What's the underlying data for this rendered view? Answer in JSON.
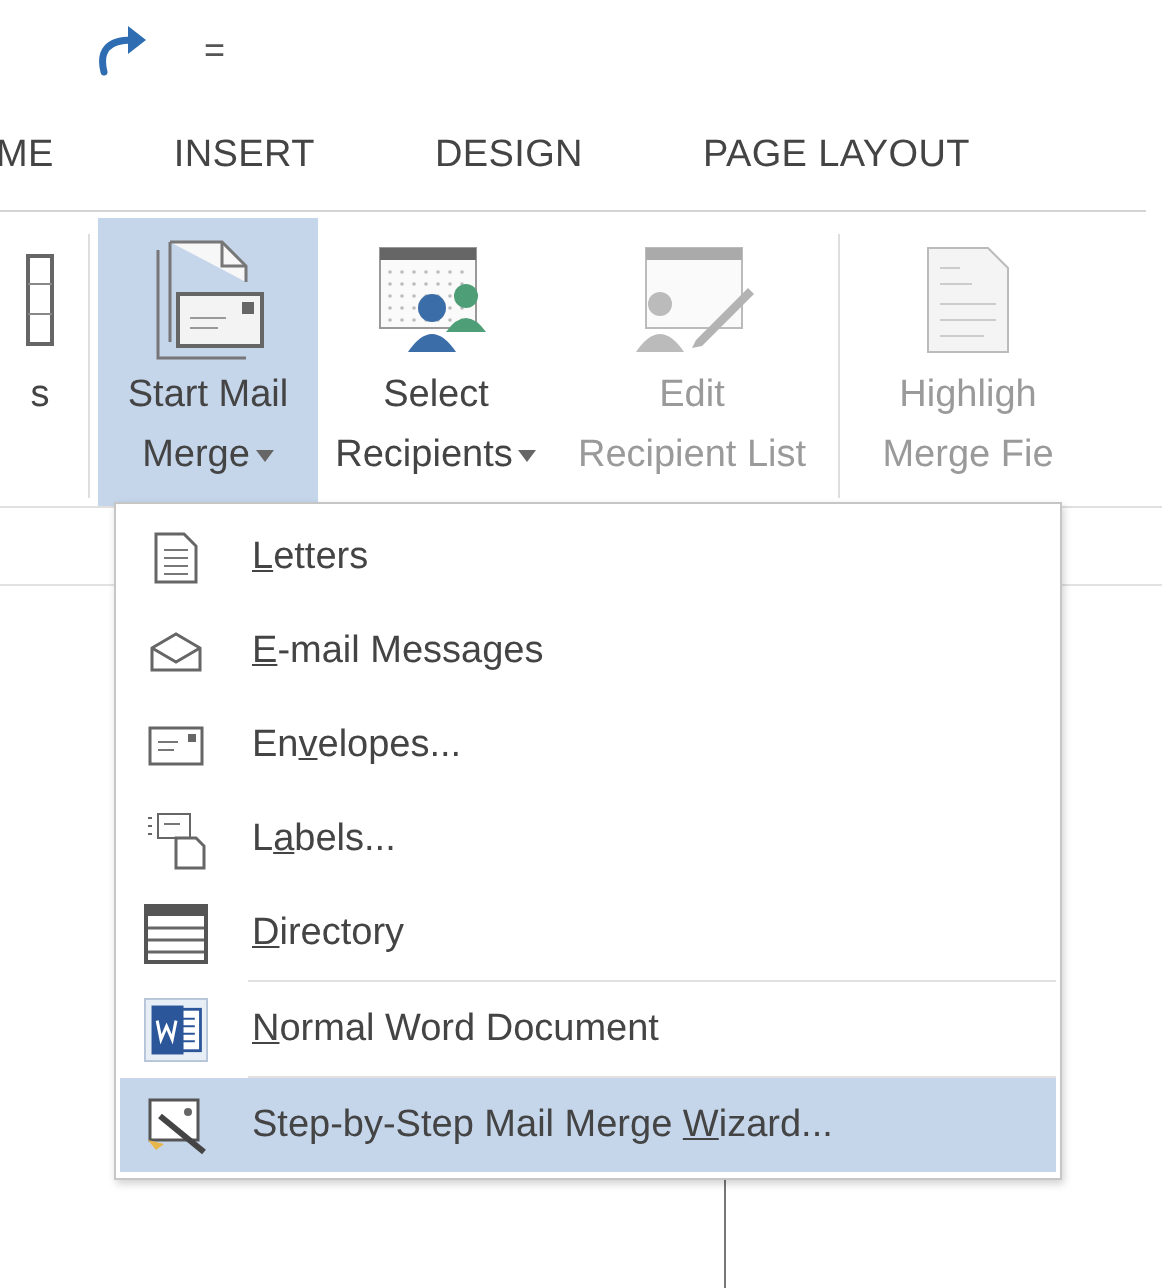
{
  "quick_access": {
    "customize": "="
  },
  "tabs": [
    {
      "label": "ME",
      "selected": false
    },
    {
      "label": "INSERT",
      "selected": false
    },
    {
      "label": "DESIGN",
      "selected": false
    },
    {
      "label": "PAGE LAYOUT",
      "selected": false
    }
  ],
  "ribbon": {
    "buttons": [
      {
        "lines": [
          "s"
        ],
        "pressed": false,
        "disabled": false,
        "dropdown": false
      },
      {
        "lines": [
          "Start Mail",
          "Merge"
        ],
        "pressed": true,
        "disabled": false,
        "dropdown": true
      },
      {
        "lines": [
          "Select",
          "Recipients"
        ],
        "pressed": false,
        "disabled": false,
        "dropdown": true
      },
      {
        "lines": [
          "Edit",
          "Recipient List"
        ],
        "pressed": false,
        "disabled": true,
        "dropdown": false
      },
      {
        "lines": [
          "Highligh",
          "Merge Fie"
        ],
        "pressed": false,
        "disabled": true,
        "dropdown": false
      }
    ]
  },
  "menu": {
    "items": [
      {
        "key": "L",
        "post": "etters",
        "selected": false,
        "separator_after": false
      },
      {
        "key": "E",
        "post": "-mail Messages",
        "selected": false,
        "separator_after": false
      },
      {
        "pre": "En",
        "key": "v",
        "post": "elopes...",
        "selected": false,
        "separator_after": false
      },
      {
        "pre": "L",
        "key": "a",
        "post": "bels...",
        "selected": false,
        "separator_after": false
      },
      {
        "key": "D",
        "post": "irectory",
        "selected": false,
        "separator_after": true
      },
      {
        "key": "N",
        "post": "ormal Word Document",
        "selected": false,
        "separator_after": true
      },
      {
        "pre": "Step-by-Step Mail Merge ",
        "key": "W",
        "post": "izard...",
        "selected": true,
        "separator_after": false
      }
    ]
  }
}
